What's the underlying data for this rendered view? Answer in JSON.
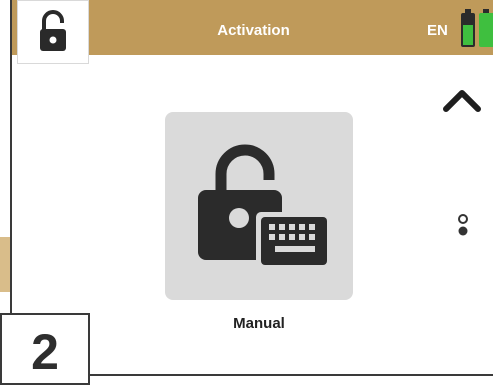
{
  "header": {
    "title": "Activation",
    "language": "EN",
    "battery_colors": [
      "#3fbf3f",
      "#3fbf3f"
    ],
    "accent": "#bf9a5a"
  },
  "tile": {
    "label": "Manual",
    "icon": "manual-unlock-keyboard-icon",
    "background": "#dadada"
  },
  "step": {
    "number": "2"
  },
  "icons": {
    "lock": "lock-open-icon",
    "up": "chevron-up-icon",
    "more": "more-dots-icon"
  }
}
